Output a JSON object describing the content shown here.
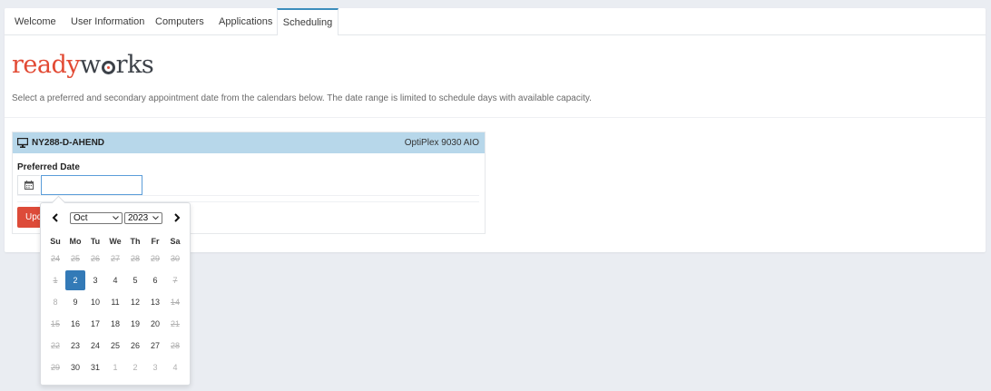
{
  "tabs": [
    {
      "label": "Welcome"
    },
    {
      "label": "User Information"
    },
    {
      "label": "Computers"
    },
    {
      "label": "Applications"
    },
    {
      "label": "Scheduling",
      "active": true
    }
  ],
  "logo": {
    "part1": "ready",
    "part2a": "w",
    "part2b": "rks"
  },
  "instructions": "Select a preferred and secondary appointment date from the calendars below. The date range is limited to schedule days with available capacity.",
  "device": {
    "icon": "monitor-icon",
    "name": "NY288-D-AHEND",
    "model": "OptiPlex 9030 AIO"
  },
  "preferred_date": {
    "label": "Preferred Date",
    "value": "",
    "calendar_icon": "calendar-icon"
  },
  "update_button": {
    "label": "Upd"
  },
  "datepicker": {
    "month": "Oct",
    "year": "2023",
    "prev_icon": "chevron-left-icon",
    "next_icon": "chevron-right-icon",
    "weekdays": [
      "Su",
      "Mo",
      "Tu",
      "We",
      "Th",
      "Fr",
      "Sa"
    ],
    "weeks": [
      [
        {
          "d": "24",
          "s": "disabled"
        },
        {
          "d": "25",
          "s": "disabled"
        },
        {
          "d": "26",
          "s": "disabled"
        },
        {
          "d": "27",
          "s": "disabled"
        },
        {
          "d": "28",
          "s": "disabled"
        },
        {
          "d": "29",
          "s": "disabled"
        },
        {
          "d": "30",
          "s": "disabled"
        }
      ],
      [
        {
          "d": "1",
          "s": "disabled"
        },
        {
          "d": "2",
          "s": "selected"
        },
        {
          "d": "3",
          "s": ""
        },
        {
          "d": "4",
          "s": ""
        },
        {
          "d": "5",
          "s": ""
        },
        {
          "d": "6",
          "s": ""
        },
        {
          "d": "7",
          "s": "disabled"
        }
      ],
      [
        {
          "d": "8",
          "s": "off"
        },
        {
          "d": "9",
          "s": ""
        },
        {
          "d": "10",
          "s": ""
        },
        {
          "d": "11",
          "s": ""
        },
        {
          "d": "12",
          "s": ""
        },
        {
          "d": "13",
          "s": ""
        },
        {
          "d": "14",
          "s": "disabled"
        }
      ],
      [
        {
          "d": "15",
          "s": "disabled"
        },
        {
          "d": "16",
          "s": ""
        },
        {
          "d": "17",
          "s": ""
        },
        {
          "d": "18",
          "s": ""
        },
        {
          "d": "19",
          "s": ""
        },
        {
          "d": "20",
          "s": ""
        },
        {
          "d": "21",
          "s": "disabled"
        }
      ],
      [
        {
          "d": "22",
          "s": "disabled"
        },
        {
          "d": "23",
          "s": ""
        },
        {
          "d": "24",
          "s": ""
        },
        {
          "d": "25",
          "s": ""
        },
        {
          "d": "26",
          "s": ""
        },
        {
          "d": "27",
          "s": ""
        },
        {
          "d": "28",
          "s": "disabled"
        }
      ],
      [
        {
          "d": "29",
          "s": "disabled"
        },
        {
          "d": "30",
          "s": ""
        },
        {
          "d": "31",
          "s": ""
        },
        {
          "d": "1",
          "s": "off"
        },
        {
          "d": "2",
          "s": "off"
        },
        {
          "d": "3",
          "s": "off"
        },
        {
          "d": "4",
          "s": "off"
        }
      ]
    ]
  },
  "colors": {
    "accent": "#3c8dbc",
    "brand_red": "#e24a34",
    "device_header": "#b7d7ea",
    "selected_day": "#337ab7",
    "button_red": "#dd4b39"
  }
}
